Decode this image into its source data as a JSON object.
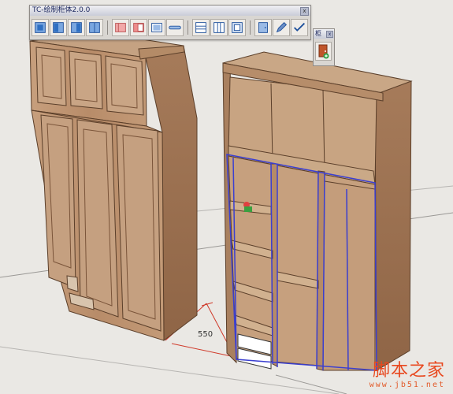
{
  "toolbar": {
    "title": "TC-绘制柜体2.0.0",
    "close_label": "x",
    "buttons": [
      {
        "icon": "cabinet-front-icon"
      },
      {
        "icon": "cabinet-left-icon"
      },
      {
        "icon": "cabinet-right-icon"
      },
      {
        "icon": "cabinet-double-icon"
      },
      {
        "icon": "panel-pink-icon"
      },
      {
        "icon": "panel-red-icon"
      },
      {
        "icon": "panel-frame-icon"
      },
      {
        "icon": "rod-icon"
      },
      {
        "icon": "shelves-icon"
      },
      {
        "icon": "split-panel-icon"
      },
      {
        "icon": "back-panel-icon"
      },
      {
        "icon": "door-panel-icon"
      },
      {
        "icon": "pen-icon"
      },
      {
        "icon": "checkmark-icon"
      }
    ]
  },
  "mini_toolbar": {
    "title": "柜",
    "close_label": "x",
    "button_icon": "door-add-icon"
  },
  "scene": {
    "dimension_label": "550"
  },
  "watermark": {
    "brand": "脚本之家",
    "url": "www.jb51.net"
  }
}
